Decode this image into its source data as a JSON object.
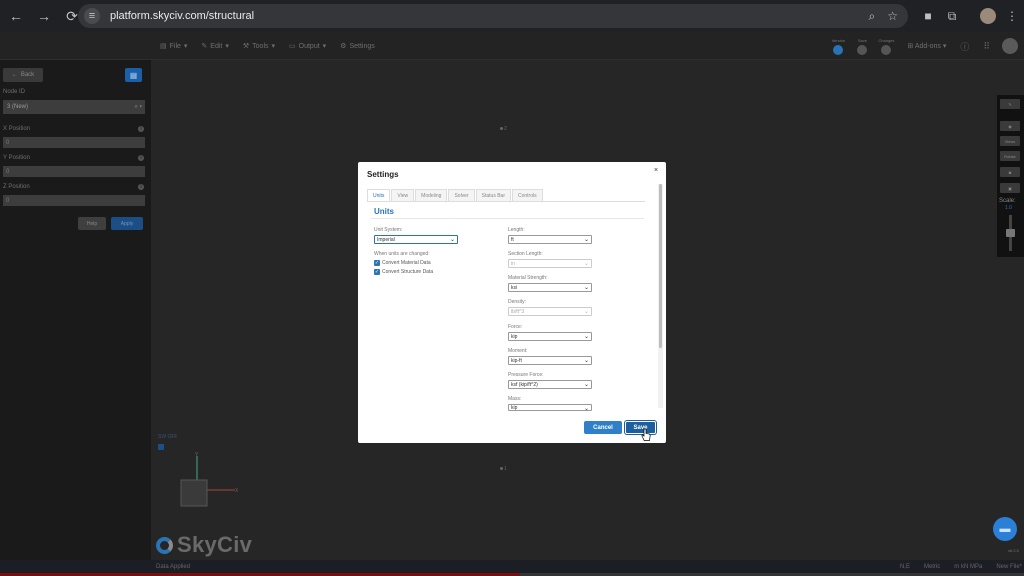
{
  "browser": {
    "url": "platform.skyciv.com/structural",
    "back_icon": "←",
    "forward_icon": "→",
    "reload_icon": "⟳",
    "more_icon": "⋮"
  },
  "app_menu": {
    "items": [
      "File",
      "Edit",
      "Tools",
      "Output",
      "Settings"
    ],
    "mini_buttons": [
      "Version",
      "Save",
      "Changes"
    ],
    "addons": "Add-ons"
  },
  "sidebar": {
    "back": "Back",
    "node_id_label": "Node ID",
    "node_id_value": "3 (New)",
    "x_label": "X Position",
    "x_value": "0",
    "y_label": "Y Position",
    "y_value": "0",
    "z_label": "Z Position",
    "z_value": "0",
    "help": "Help",
    "apply": "Apply"
  },
  "canvas": {
    "node_2": "2",
    "node_1": "1",
    "sw_label": "SW OFF",
    "axis_x": "X",
    "axis_y": "Y"
  },
  "right_tools": {
    "views": "Views",
    "rotate": "Rotate",
    "scale_label": "Scale:",
    "scale_value": "1.0"
  },
  "logo_text": "SkyCiv",
  "version": "v6.2.0",
  "status_bar": {
    "left": "Data Applied",
    "items": [
      "N,E",
      "Metric",
      "m  kN  MPa",
      "New File*"
    ]
  },
  "modal": {
    "title": "Settings",
    "close": "×",
    "tabs": [
      "Units",
      "View",
      "Modeling",
      "Solver",
      "Status Bar",
      "Controls"
    ],
    "active_tab": "Units",
    "section": "Units",
    "unit_system_label": "Unit System:",
    "unit_system_value": "Imperial",
    "when_changed_label": "When units are changed:",
    "checkbox_material": "Convert Material Data",
    "checkbox_structure": "Convert Structure Data",
    "length_label": "Length:",
    "length_value": "ft",
    "section_length_label": "Section Length:",
    "section_length_value": "in",
    "material_strength_label": "Material Strength:",
    "material_strength_value": "ksi",
    "density_label": "Density:",
    "density_value": "lb/ft^3",
    "force_label": "Force:",
    "force_value": "kip",
    "moment_label": "Moment:",
    "moment_value": "kip-ft",
    "pressure_label": "Pressure Force:",
    "pressure_value": "ksf (kip/ft^2)",
    "mass_label": "Mass:",
    "mass_value": "kip",
    "cancel": "Cancel",
    "save": "Save"
  },
  "colors": {
    "accent": "#2a73b5",
    "primary_button": "#2f80c8",
    "save_button": "#1d5e9e",
    "background": "#262626"
  }
}
